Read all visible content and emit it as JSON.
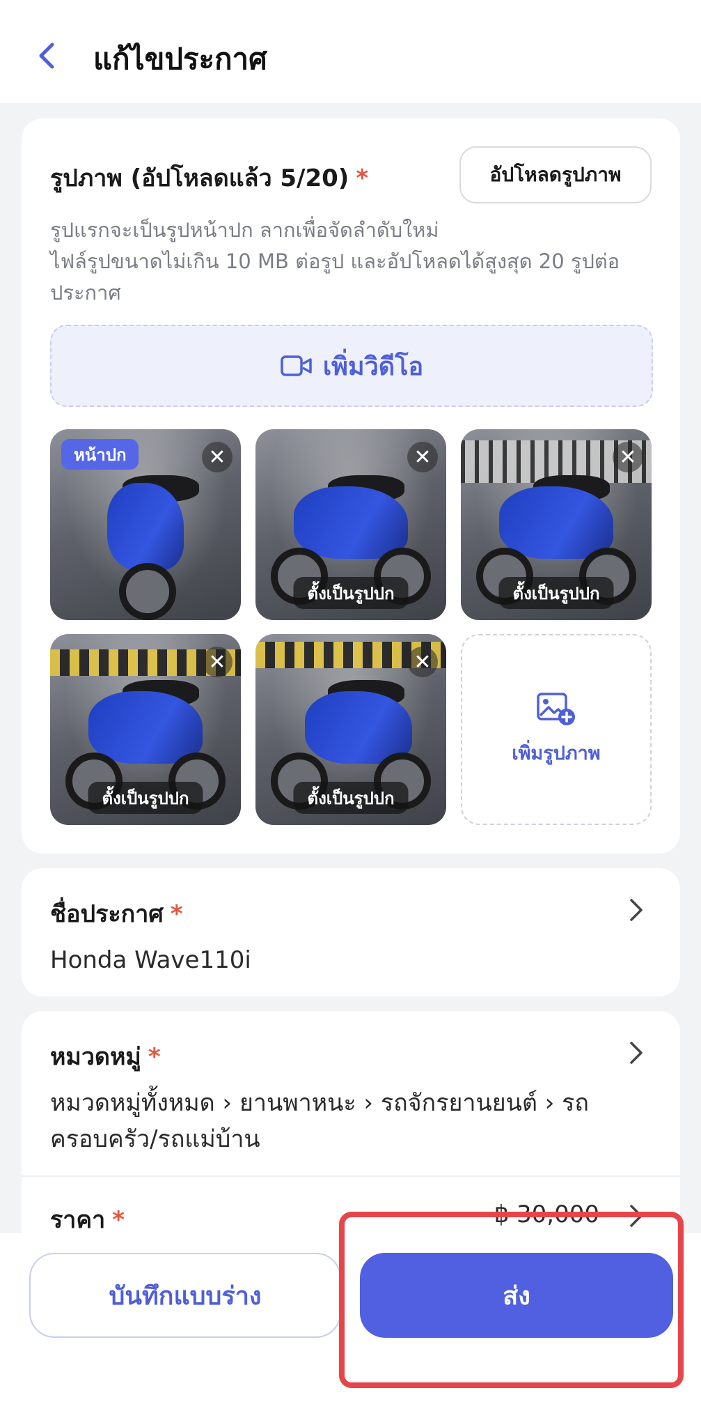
{
  "header": {
    "title": "แก้ไขประกาศ"
  },
  "photos": {
    "title": "รูปภาพ (อัปโหลดแล้ว 5/20)",
    "required_mark": "*",
    "upload_button": "อัปโหลดรูปภาพ",
    "description_line1": "รูปแรกจะเป็นรูปหน้าปก ลากเพื่อจัดลำดับใหม่",
    "description_line2": "ไฟล์รูปขนาดไม่เกิน 10 MB ต่อรูป และอัปโหลดได้สูงสุด 20 รูปต่อประกาศ",
    "add_video": "เพิ่มวิดีโอ",
    "cover_badge": "หน้าปก",
    "set_cover_label": "ตั้งเป็นรูปปก",
    "add_photo": "เพิ่มรูปภาพ",
    "close_icon_glyph": "✕"
  },
  "listing_title": {
    "label": "ชื่อประกาศ",
    "required_mark": "*",
    "value": "Honda Wave110i"
  },
  "category": {
    "label": "หมวดหมู่",
    "required_mark": "*",
    "value": "หมวดหมู่ทั้งหมด › ยานพาหนะ › รถจักรยานยนต์ › รถครอบครัว/รถแม่บ้าน"
  },
  "price": {
    "label": "ราคา",
    "required_mark": "*",
    "value": "฿ 30,000"
  },
  "actions": {
    "save_draft": "บันทึกแบบร่าง",
    "submit": "ส่ง"
  },
  "colors": {
    "accent": "#5060e0",
    "required": "#e2563f",
    "highlight": "#e8454a"
  }
}
